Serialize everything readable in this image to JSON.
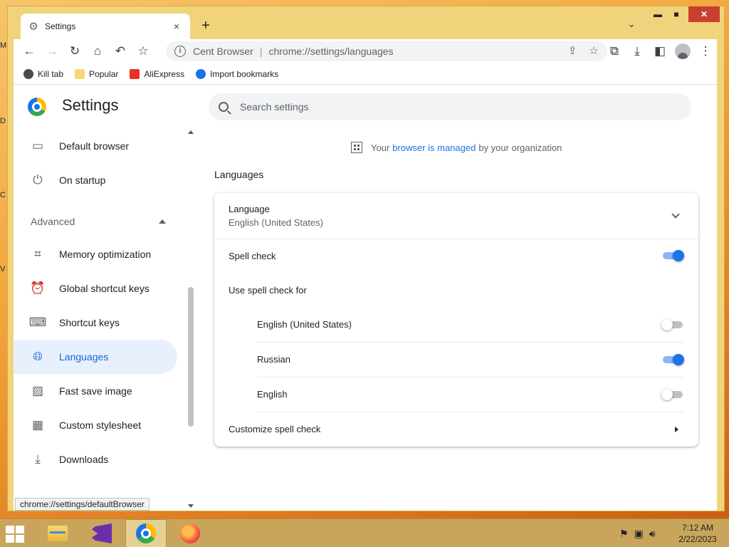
{
  "tab": {
    "title": "Settings",
    "close": "×"
  },
  "window": {
    "min": "▬",
    "max": "■",
    "close": "✕"
  },
  "toolbar": {
    "site_label": "Cent Browser",
    "url": "chrome://settings/languages"
  },
  "bookmarks": [
    {
      "label": "Kill tab"
    },
    {
      "label": "Popular"
    },
    {
      "label": "AliExpress"
    },
    {
      "label": "Import bookmarks"
    }
  ],
  "settings": {
    "title": "Settings",
    "search_placeholder": "Search settings",
    "managed": {
      "prefix": "Your",
      "link": "browser is managed",
      "suffix": "by your organization"
    }
  },
  "sidebar": {
    "items": [
      {
        "label": "Default browser",
        "icon": "browser-window-icon"
      },
      {
        "label": "On startup",
        "icon": "power-icon"
      }
    ],
    "advanced_label": "Advanced",
    "advanced_items": [
      {
        "label": "Memory optimization",
        "icon": "chip-icon"
      },
      {
        "label": "Global shortcut keys",
        "icon": "alarm-clock-icon"
      },
      {
        "label": "Shortcut keys",
        "icon": "keyboard-icon"
      },
      {
        "label": "Languages",
        "icon": "globe-icon",
        "active": true
      },
      {
        "label": "Fast save image",
        "icon": "image-icon"
      },
      {
        "label": "Custom stylesheet",
        "icon": "stylesheet-icon"
      },
      {
        "label": "Downloads",
        "icon": "download-icon"
      }
    ],
    "tooltip": "chrome://settings/defaultBrowser"
  },
  "languages": {
    "section_title": "Languages",
    "language_label": "Language",
    "language_value": "English (United States)",
    "spell_check_label": "Spell check",
    "spell_check_on": true,
    "use_for_label": "Use spell check for",
    "spell_languages": [
      {
        "label": "English (United States)",
        "on": false
      },
      {
        "label": "Russian",
        "on": true
      },
      {
        "label": "English",
        "on": false
      }
    ],
    "customize_label": "Customize spell check"
  },
  "taskbar": {
    "clock_time": "7:12 AM",
    "clock_date": "2/22/2023"
  },
  "colors": {
    "accent": "#1a73e8",
    "active_nav_bg": "#e8f0fe",
    "window_frame": "#f1d37c"
  }
}
